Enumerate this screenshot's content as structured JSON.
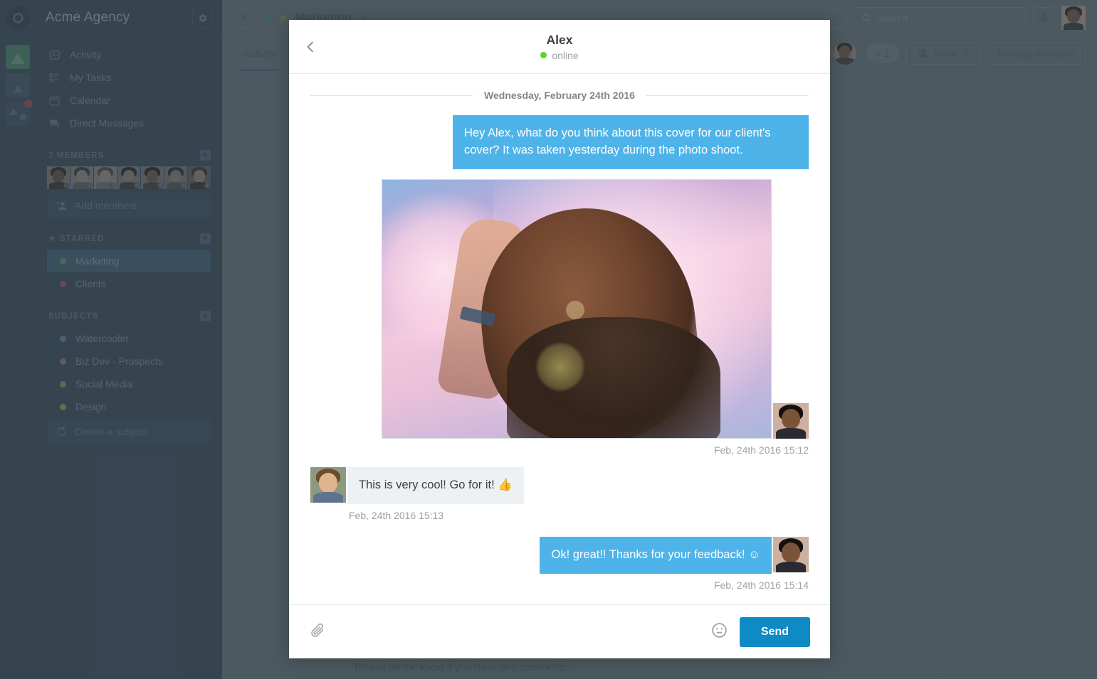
{
  "workspace": {
    "name": "Acme Agency",
    "gear_icon": "gear-icon",
    "help_icon": "question-mark-icon"
  },
  "sidebar": {
    "nav": [
      {
        "label": "Activity",
        "icon": "activity-icon"
      },
      {
        "label": "My Tasks",
        "icon": "tasks-icon"
      },
      {
        "label": "Calendar",
        "icon": "calendar-icon"
      },
      {
        "label": "Direct Messages",
        "icon": "chat-icon"
      }
    ],
    "members_header": "7 MEMBERS",
    "members_count": 7,
    "add_members_label": "Add members",
    "starred_header": "STARRED",
    "starred": [
      {
        "label": "Marketing",
        "color": "#4c8a5e",
        "selected": true
      },
      {
        "label": "Clients",
        "color": "#8c4a4a",
        "selected": false
      }
    ],
    "subjects_header": "SUBJECTS",
    "subjects": [
      {
        "label": "Watercooler",
        "color": "#4a7fa8"
      },
      {
        "label": "Biz Dev - Prospects",
        "color": "#8a5f96"
      },
      {
        "label": "Social Media",
        "color": "#9a7e3e"
      },
      {
        "label": "Design",
        "color": "#93963e"
      }
    ],
    "create_subject_label": "Create a subject"
  },
  "topbar": {
    "collapse_icon": "chevron-left-icon",
    "add_icon": "plus-icon",
    "channel_name": "Marketing",
    "channel_starred": true,
    "search_placeholder": "Search",
    "search_icon": "search-icon",
    "bell_icon": "bell-icon",
    "avatar": "avatar"
  },
  "subbar": {
    "tabs": [
      {
        "label": "Activity",
        "active": true
      }
    ],
    "overflow_label": "+ 2",
    "invite_label": "Invite",
    "invite_caret": "chevron-down-icon",
    "manage_label": "Manage members"
  },
  "background": {
    "note_text": "Please let me know if you have any comments."
  },
  "modal": {
    "back_icon": "chevron-left-icon",
    "title": "Alex",
    "status": "online",
    "status_color": "#56d72d",
    "day_separator": "Wednesday, February 24th 2016",
    "messages": [
      {
        "side": "right",
        "type": "text",
        "text": "Hey Alex, what do you think about this cover for our client's cover? It was taken yesterday during the photo shoot.",
        "timestamp": ""
      },
      {
        "side": "right",
        "type": "image",
        "alt": "backlit-portrait-photo",
        "timestamp": "Feb, 24th 2016 15:12"
      },
      {
        "side": "left",
        "type": "text",
        "text": "This is very cool! Go for it! 👍",
        "timestamp": "Feb, 24th 2016 15:13"
      },
      {
        "side": "right",
        "type": "text",
        "text": "Ok! great!! Thanks for your feedback! ☺",
        "timestamp": "Feb, 24th 2016 15:14"
      }
    ],
    "composer": {
      "attach_icon": "paperclip-icon",
      "emoji_icon": "smiley-icon",
      "send_label": "Send",
      "send_color": "#0e8bc4"
    }
  },
  "colors": {
    "sidebar_bg": "#28394a",
    "main_bg": "#5a666d",
    "bubble_me": "#4eb3e8",
    "bubble_them": "#eef1f3",
    "accent": "#0e8bc4"
  }
}
